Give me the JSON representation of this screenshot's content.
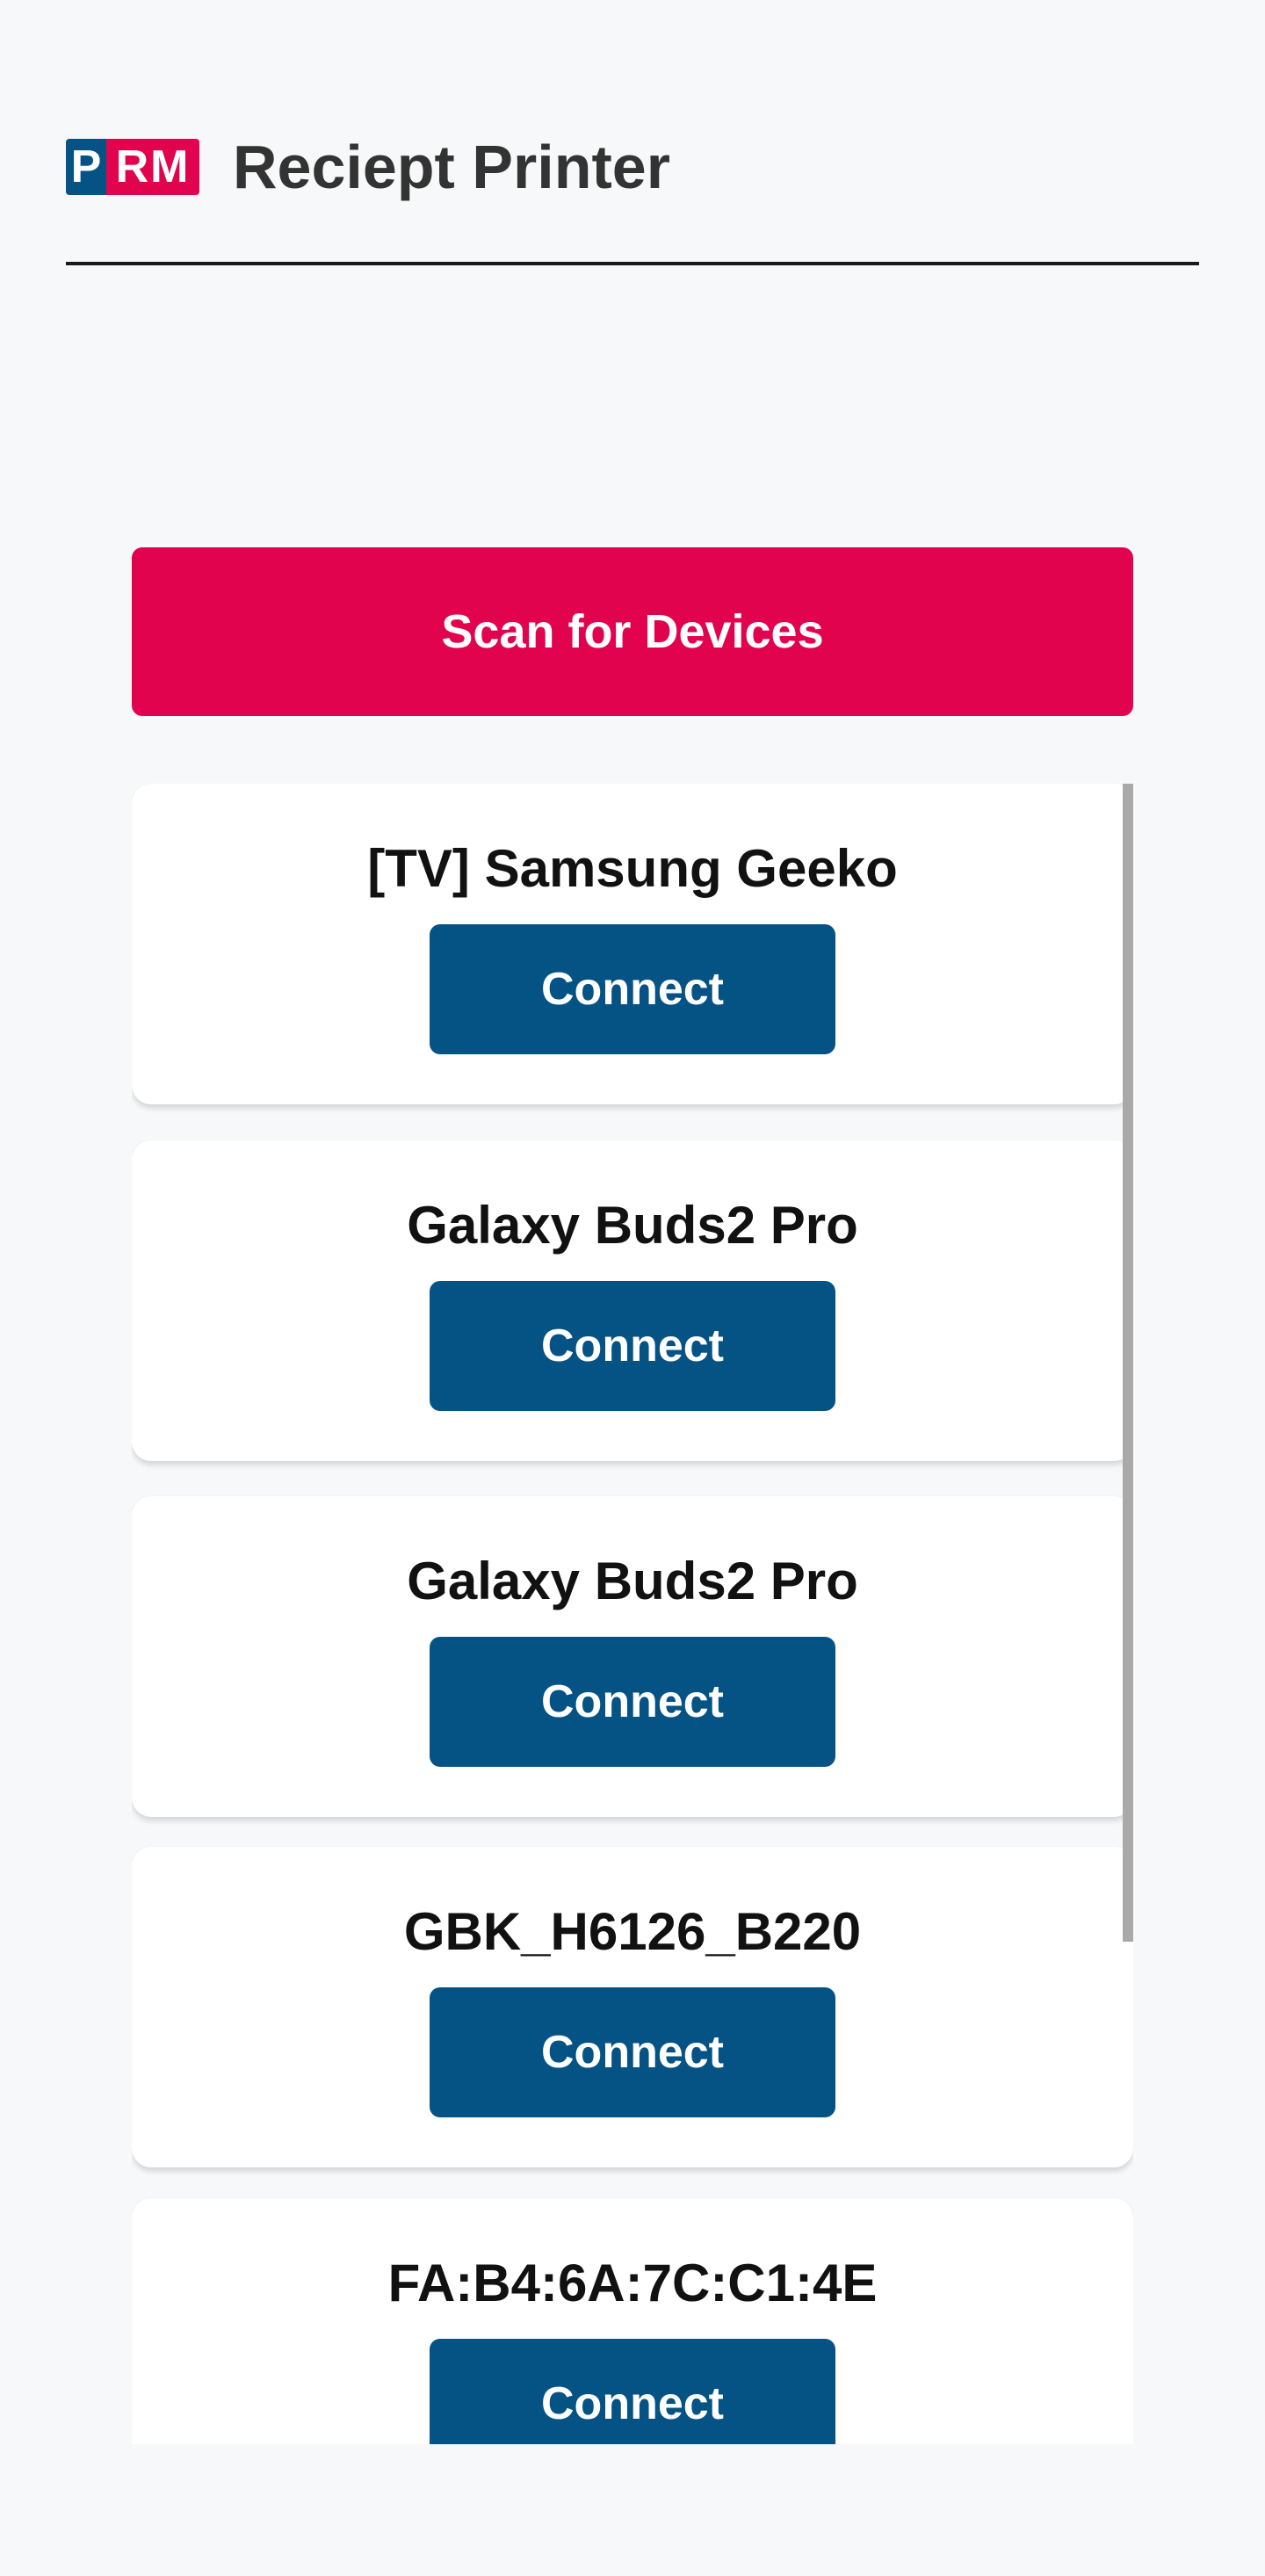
{
  "header": {
    "logo_p": "P",
    "logo_rm": "RM",
    "title": "Reciept Printer"
  },
  "scan_button": {
    "label": "Scan for Devices"
  },
  "devices": [
    {
      "name": "[TV] Samsung Geeko",
      "button": "Connect"
    },
    {
      "name": "Galaxy Buds2 Pro",
      "button": "Connect"
    },
    {
      "name": "Galaxy Buds2 Pro",
      "button": "Connect"
    },
    {
      "name": "GBK_H6126_B220",
      "button": "Connect"
    },
    {
      "name": "FA:B4:6A:7C:C1:4E",
      "button": "Connect"
    }
  ],
  "colors": {
    "brand_pink": "#e2034f",
    "brand_blue": "#055285",
    "background": "#f7f8fa"
  }
}
